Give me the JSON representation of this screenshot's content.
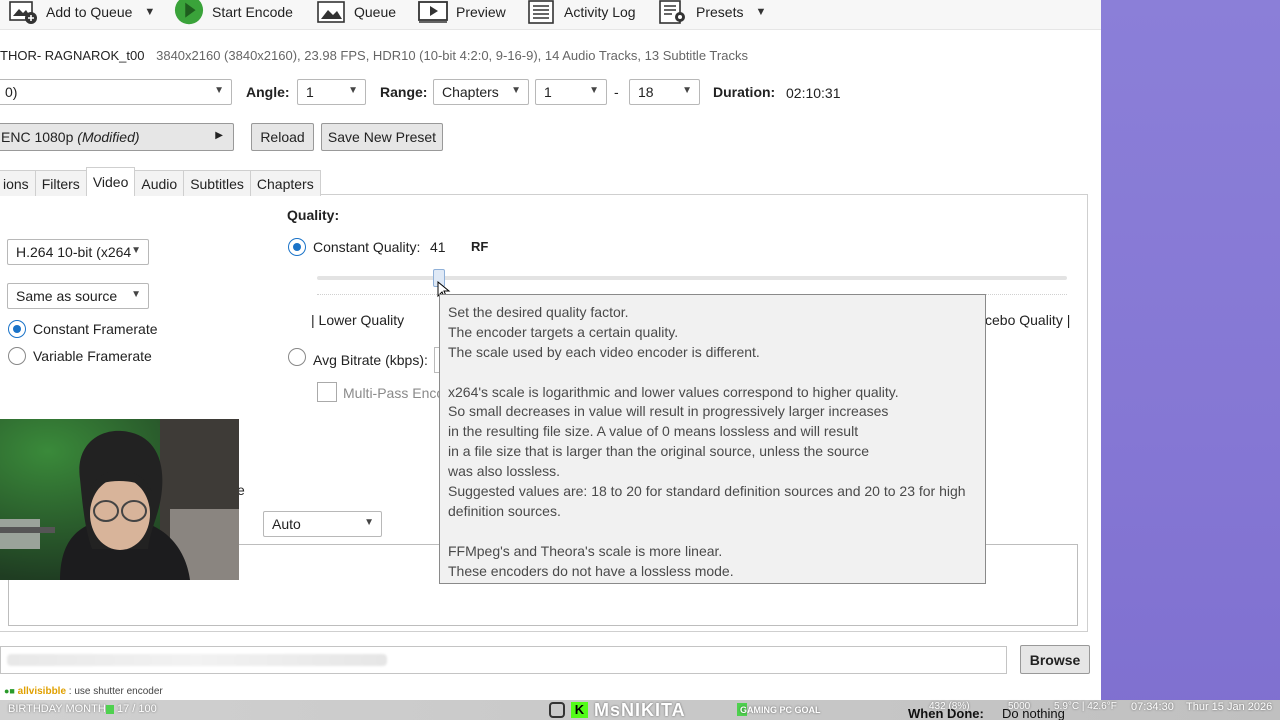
{
  "toolbar": {
    "add_to_queue": "Add to Queue",
    "start_encode": "Start Encode",
    "queue": "Queue",
    "preview": "Preview",
    "activity_log": "Activity Log",
    "presets": "Presets"
  },
  "source_info": {
    "title": "THOR- RAGNAROK_t00",
    "details": "3840x2160 (3840x2160), 23.98 FPS, HDR10 (10-bit 4:2:0, 9-16-9), 14 Audio Tracks, 13 Subtitle Tracks"
  },
  "source_row": {
    "title_select_value": "0)",
    "angle_label": "Angle:",
    "angle_value": "1",
    "range_label": "Range:",
    "range_type": "Chapters",
    "range_start": "1",
    "range_sep": "-",
    "range_end": "18",
    "duration_label": "Duration:",
    "duration_value": "02:10:31"
  },
  "preset_row": {
    "preset_name": "ENC 1080p",
    "preset_modified": "(Modified)",
    "reload": "Reload",
    "save_new_preset": "Save New Preset"
  },
  "tabs": [
    {
      "label": "ions",
      "active": false
    },
    {
      "label": "Filters",
      "active": false
    },
    {
      "label": "Video",
      "active": true
    },
    {
      "label": "Audio",
      "active": false
    },
    {
      "label": "Subtitles",
      "active": false
    },
    {
      "label": "Chapters",
      "active": false
    }
  ],
  "video": {
    "encoder": "H.264 10-bit (x264",
    "framerate": "Same as source",
    "constant_framerate": "Constant Framerate",
    "variable_framerate": "Variable Framerate",
    "quality_heading": "Quality:",
    "constant_quality_label": "Constant Quality:",
    "constant_quality_value": "41",
    "rf_label": "RF",
    "slider_fraction": 0.162,
    "lower_quality": "| Lower Quality",
    "placebo_quality": "cebo Quality |",
    "avg_bitrate_label": "Avg Bitrate (kbps):",
    "multipass_label": "Multi-Pass Enco",
    "tune_letter": "e",
    "auto_select": "Auto"
  },
  "tooltip": {
    "lines": [
      "Set the desired quality factor.",
      "The encoder targets a certain quality.",
      "The scale used by each video encoder is different.",
      "",
      "x264's scale is logarithmic and lower values correspond to higher quality.",
      "So small decreases in value will result in progressively larger increases",
      "in the resulting file size.  A value of 0 means lossless and will result",
      "in a file size that is larger than the original source, unless the source",
      "was also lossless.",
      "Suggested values are: 18 to 20 for standard definition sources and 20 to 23 for high",
      "definition sources.",
      "",
      "FFMpeg's and Theora's scale is more linear.",
      "These encoders do not have a lossless mode."
    ]
  },
  "destination": {
    "browse": "Browse"
  },
  "stream_overlay": {
    "chat_user": "allvisibble",
    "chat_text": ": use shutter encoder",
    "birthday_label": "BIRTHDAY MONTH",
    "birthday_count": "17 / 100",
    "channel_name": "MsNIKITA",
    "gaming_goal": "GAMING PC GOAL",
    "goal_progress": "432 (8%)",
    "goal_target": "5000",
    "temperature": "5.9°C | 42.6°F",
    "time": "07:34:30",
    "date": "Thur 15 Jan 2026",
    "when_done_label": "When Done:",
    "when_done_value": "Do nothing"
  },
  "colors": {
    "accent_radio": "#1a73c8",
    "side_panel": "#8b7fd8",
    "goal_green": "#4fd14f"
  }
}
